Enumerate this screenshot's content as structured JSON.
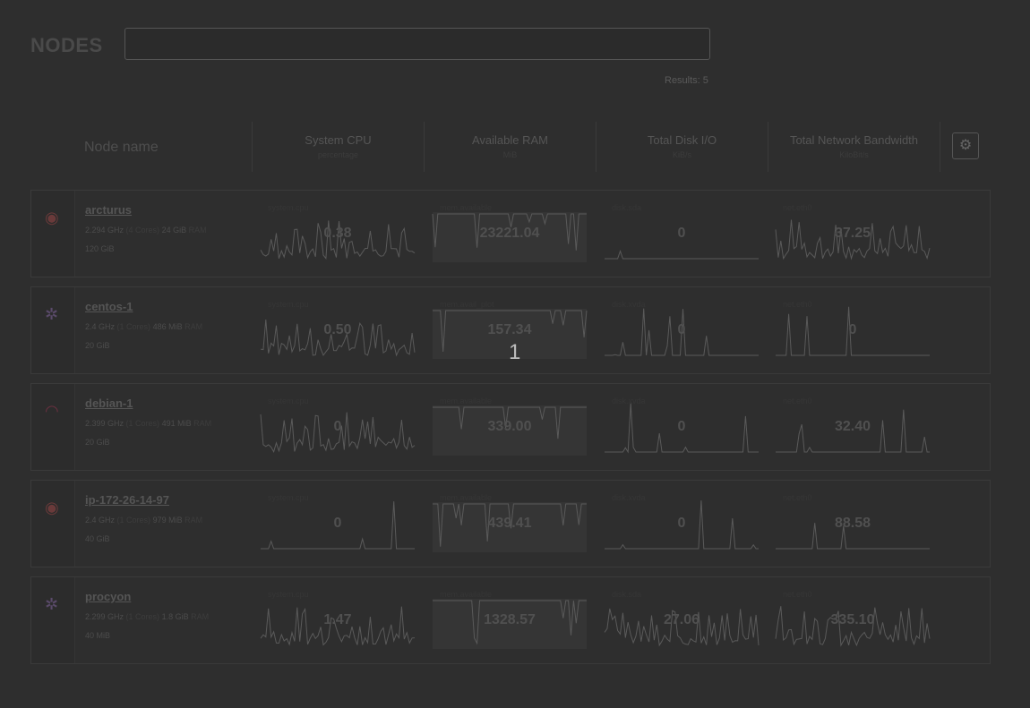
{
  "page": {
    "title": "NODES",
    "search": {
      "value": "",
      "placeholder": ""
    },
    "results": "Results: 5",
    "overlay": "1"
  },
  "header": {
    "node_name": "Node name",
    "columns": [
      {
        "title": "System CPU",
        "unit": "percentage"
      },
      {
        "title": "Available RAM",
        "unit": "MiB"
      },
      {
        "title": "Total Disk I/O",
        "unit": "KiB/s"
      },
      {
        "title": "Total Network Bandwidth",
        "unit": "KiloBit/s"
      }
    ],
    "settings_icon": "gear-icon"
  },
  "colors": {
    "background": "#2e2e2e",
    "sparkline": "#5a5a5a",
    "ram_fill": "#353535"
  },
  "nodes": [
    {
      "name": "arcturus",
      "logo": "debian-swirl-icon",
      "cpu": "2.294 GHz",
      "cores": "(4 Cores)",
      "ram": "24 GiB",
      "ram_label": "RAM",
      "disk": "120 GiB",
      "metrics": [
        {
          "label": "system.cpu",
          "value": "0.38"
        },
        {
          "label": "mem.available",
          "value": "23221.04"
        },
        {
          "label": "disk.sda",
          "value": "0"
        },
        {
          "label": "net.eth0",
          "value": "37.25"
        }
      ]
    },
    {
      "name": "centos-1",
      "logo": "centos-icon",
      "cpu": "2.4 GHz",
      "cores": "(1 Cores)",
      "ram": "486 MiB",
      "ram_label": "RAM",
      "disk": "20 GiB",
      "metrics": [
        {
          "label": "system.cpu",
          "value": "0.50"
        },
        {
          "label": "mem.avail_plot",
          "value": "157.34"
        },
        {
          "label": "disk.xvda",
          "value": "0"
        },
        {
          "label": "net.eth0",
          "value": "0"
        }
      ]
    },
    {
      "name": "debian-1",
      "logo": "debian-icon",
      "cpu": "2.399 GHz",
      "cores": "(1 Cores)",
      "ram": "491 MiB",
      "ram_label": "RAM",
      "disk": "20 GiB",
      "metrics": [
        {
          "label": "system.cpu",
          "value": "0"
        },
        {
          "label": "mem.available",
          "value": "339.00"
        },
        {
          "label": "disk.xvda",
          "value": "0"
        },
        {
          "label": "net.eth0",
          "value": "32.40"
        }
      ]
    },
    {
      "name": "ip-172-26-14-97",
      "logo": "debian-swirl-icon",
      "cpu": "2.4 GHz",
      "cores": "(1 Cores)",
      "ram": "979 MiB",
      "ram_label": "RAM",
      "disk": "40 GiB",
      "metrics": [
        {
          "label": "system.cpu",
          "value": "0"
        },
        {
          "label": "mem.available",
          "value": "439.41"
        },
        {
          "label": "disk.xvda",
          "value": "0"
        },
        {
          "label": "net.eth0",
          "value": "88.58"
        }
      ]
    },
    {
      "name": "procyon",
      "logo": "centos-icon",
      "cpu": "2.299 GHz",
      "cores": "(1 Cores)",
      "ram": "1.8 GiB",
      "ram_label": "RAM",
      "disk": "40 MiB",
      "metrics": [
        {
          "label": "system.cpu",
          "value": "1.47"
        },
        {
          "label": "mem.available",
          "value": "1328.57"
        },
        {
          "label": "disk.sda",
          "value": "27.06"
        },
        {
          "label": "net.eth0",
          "value": "335.10"
        }
      ]
    }
  ]
}
